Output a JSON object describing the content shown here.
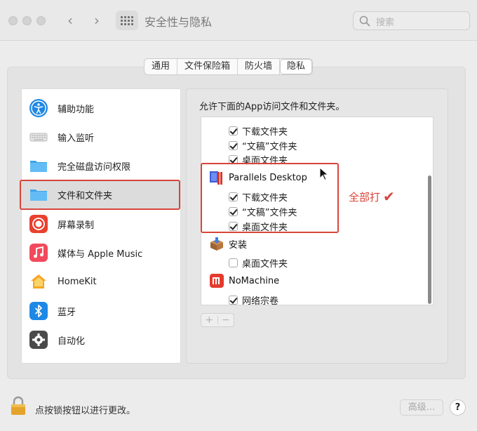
{
  "window": {
    "title": "安全性与隐私",
    "search_placeholder": "搜索"
  },
  "tabs": [
    {
      "label": "通用",
      "active": false
    },
    {
      "label": "文件保险箱",
      "active": false
    },
    {
      "label": "防火墙",
      "active": false
    },
    {
      "label": "隐私",
      "active": true
    }
  ],
  "sidebar": {
    "items": [
      {
        "label": "辅助功能",
        "icon": "accessibility-icon"
      },
      {
        "label": "输入监听",
        "icon": "keyboard-icon"
      },
      {
        "label": "完全磁盘访问权限",
        "icon": "folder-icon"
      },
      {
        "label": "文件和文件夹",
        "icon": "folder-icon",
        "selected": true
      },
      {
        "label": "屏幕录制",
        "icon": "screen-record-icon"
      },
      {
        "label": "媒体与 Apple Music",
        "icon": "music-icon"
      },
      {
        "label": "HomeKit",
        "icon": "home-icon"
      },
      {
        "label": "蓝牙",
        "icon": "bluetooth-icon"
      },
      {
        "label": "自动化",
        "icon": "gear-icon"
      }
    ]
  },
  "panel": {
    "heading": "允许下面的App访问文件和文件夹。",
    "list": {
      "top_items": [
        {
          "label": "下载文件夹",
          "checked": true
        },
        {
          "label": "“文稿”文件夹",
          "checked": true
        },
        {
          "label": "桌面文件夹",
          "checked": true
        }
      ],
      "apps": [
        {
          "name": "Parallels Desktop",
          "icon": "parallels-icon",
          "items": [
            {
              "label": "下载文件夹",
              "checked": true
            },
            {
              "label": "“文稿”文件夹",
              "checked": true
            },
            {
              "label": "桌面文件夹",
              "checked": true
            }
          ]
        },
        {
          "name": "安装",
          "icon": "installer-icon",
          "items": [
            {
              "label": "桌面文件夹",
              "checked": false
            }
          ]
        },
        {
          "name": "NoMachine",
          "icon": "nomachine-icon",
          "items": [
            {
              "label": "网络宗卷",
              "checked": true
            }
          ]
        }
      ]
    },
    "add_label": "+",
    "remove_label": "−"
  },
  "annotation": {
    "text": "全部打",
    "mark": "✔"
  },
  "footer": {
    "lock_text": "点按锁按钮以进行更改。",
    "advanced_label": "高级...",
    "help_label": "?"
  },
  "colors": {
    "highlight": "#d8453a",
    "accent_blue": "#1e88e5"
  }
}
